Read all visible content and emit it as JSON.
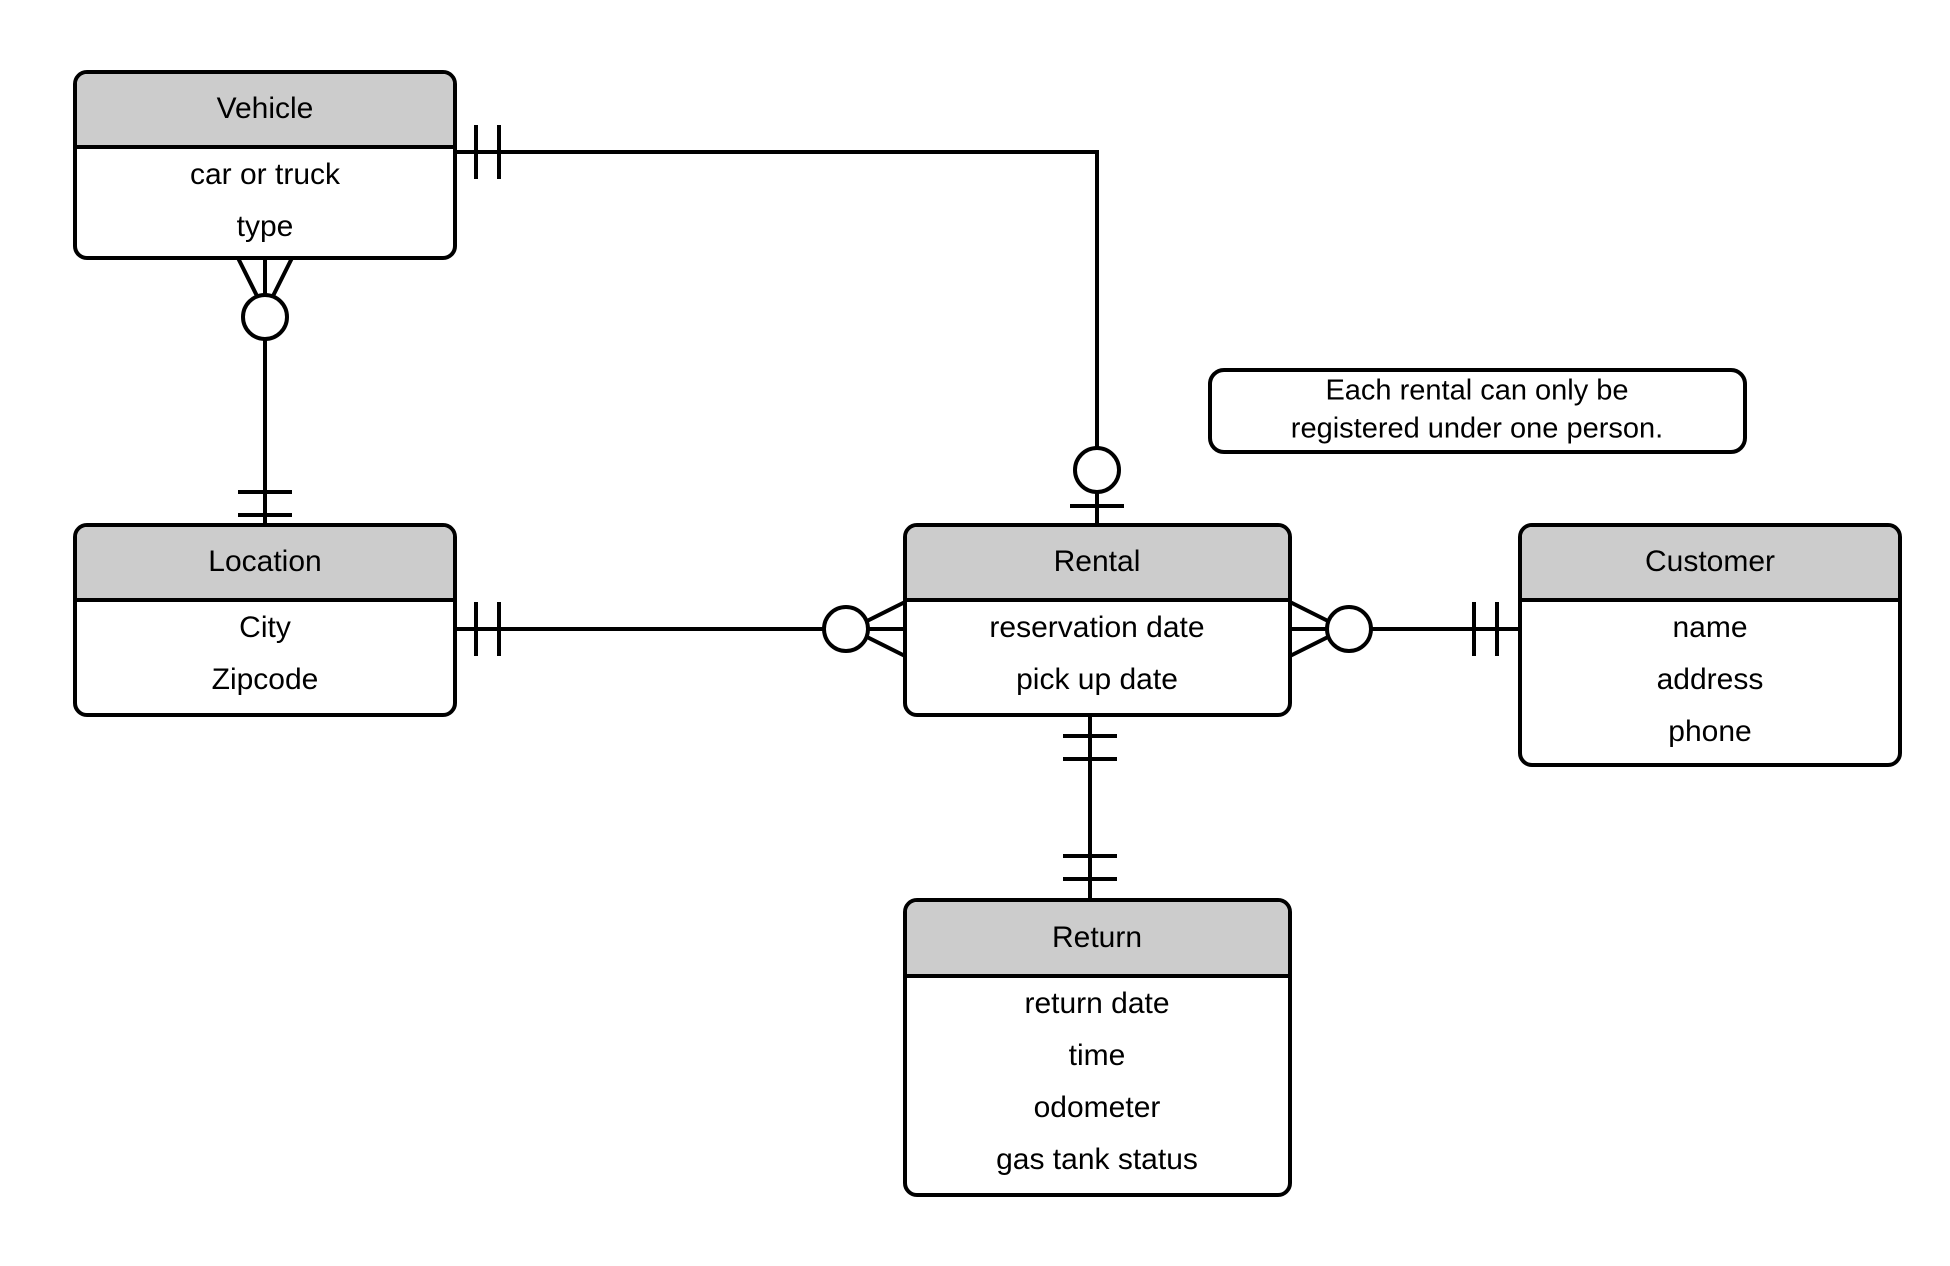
{
  "diagram": {
    "type": "entity-relationship-diagram",
    "notation": "crow's foot",
    "background_color": "#ffffff",
    "header_fill_color": "#cccccc",
    "body_fill_color": "#ffffff",
    "stroke_color": "#000000"
  },
  "entities": [
    {
      "id": "vehicle",
      "title": "Vehicle",
      "attributes": [
        "car or truck",
        "type"
      ]
    },
    {
      "id": "location",
      "title": "Location",
      "attributes": [
        "City",
        "Zipcode"
      ]
    },
    {
      "id": "rental",
      "title": "Rental",
      "attributes": [
        "reservation date",
        "pick up date"
      ]
    },
    {
      "id": "customer",
      "title": "Customer",
      "attributes": [
        "name",
        "address",
        "phone"
      ]
    },
    {
      "id": "return",
      "title": "Return",
      "attributes": [
        "return date",
        "time",
        "odometer",
        "gas tank status"
      ]
    }
  ],
  "notes": [
    {
      "id": "rental-person-note",
      "line1": "Each rental can only be",
      "line2": "registered under one person."
    }
  ],
  "relationships": [
    {
      "id": "vehicle-location",
      "from": "vehicle",
      "to": "location",
      "from_cardinality": "zero or many",
      "to_cardinality": "one and only one"
    },
    {
      "id": "vehicle-rental",
      "from": "vehicle",
      "to": "rental",
      "from_cardinality": "one and only one",
      "to_cardinality": "zero or one"
    },
    {
      "id": "location-rental",
      "from": "location",
      "to": "rental",
      "from_cardinality": "one and only one",
      "to_cardinality": "zero or many"
    },
    {
      "id": "rental-customer",
      "from": "rental",
      "to": "customer",
      "from_cardinality": "zero or many",
      "to_cardinality": "one and only one"
    },
    {
      "id": "rental-return",
      "from": "rental",
      "to": "return",
      "from_cardinality": "one and only one",
      "to_cardinality": "one and only one"
    }
  ]
}
